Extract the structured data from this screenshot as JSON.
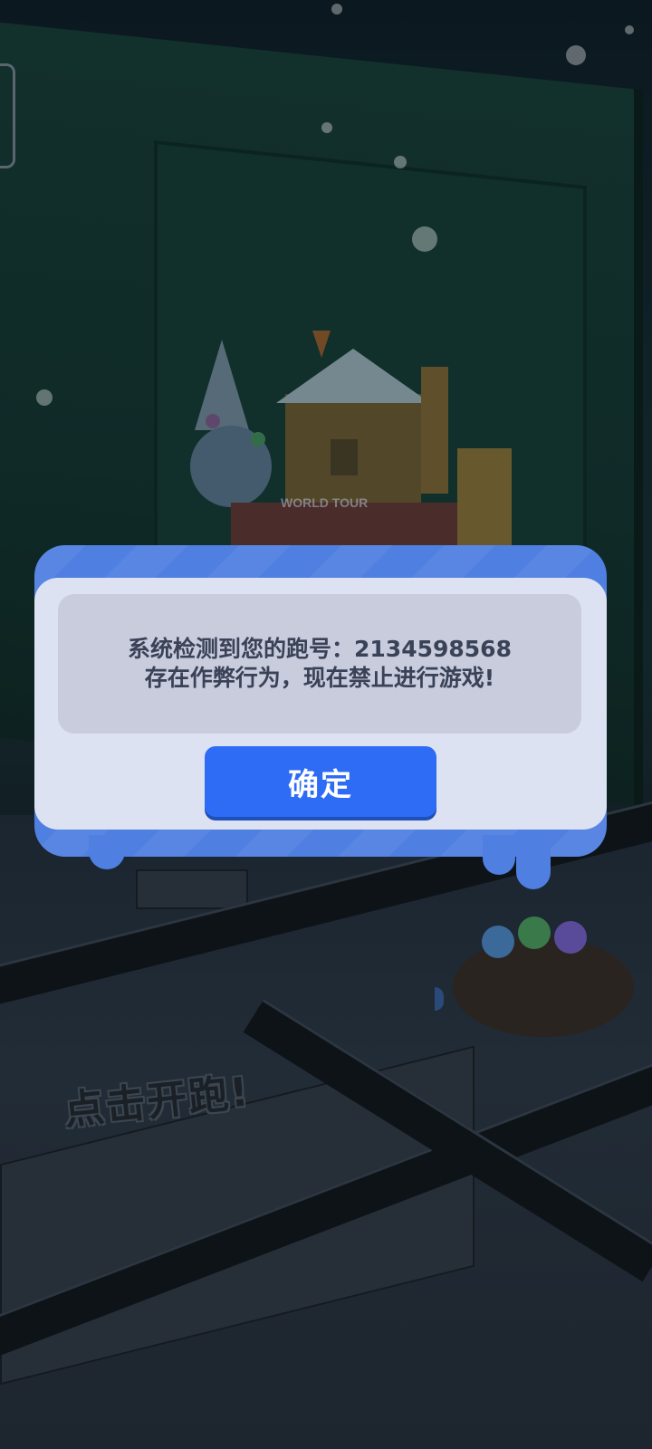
{
  "background": {
    "logo_text": "WORLD TOUR",
    "tap_to_run": "点击开跑!"
  },
  "dialog": {
    "message_line1": "系统检测到您的跑号：2134598568",
    "message_line2": "存在作弊行为，现在禁止进行游戏!",
    "confirm_label": "确定"
  },
  "colors": {
    "dialog_frame": "#4f7fe0",
    "dialog_face": "#dde2f3",
    "message_box": "#c9ccdd",
    "button": "#2e6cf6"
  }
}
